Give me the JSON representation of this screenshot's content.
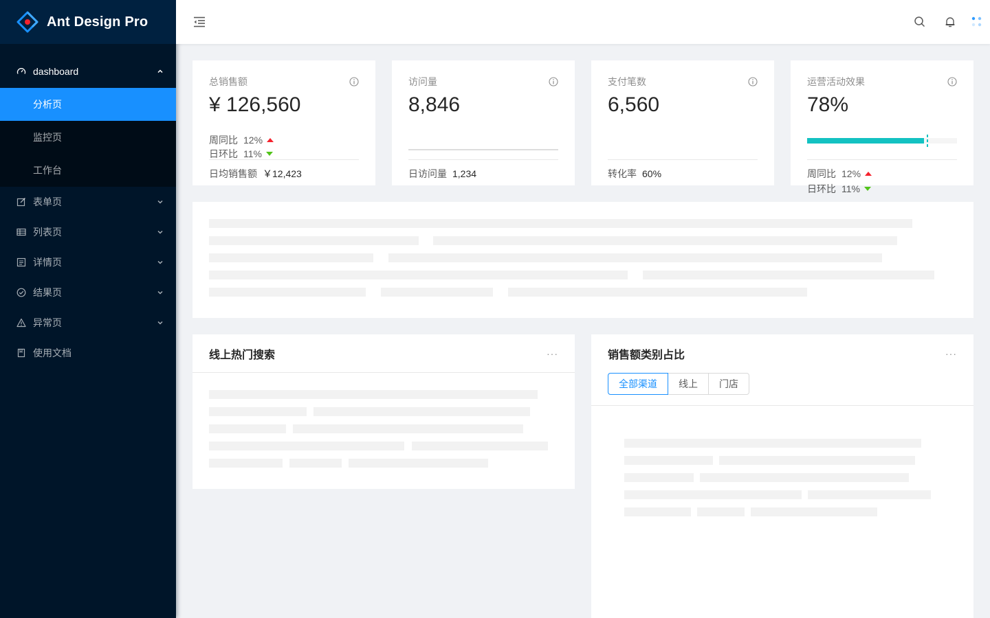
{
  "app": {
    "title": "Ant Design Pro"
  },
  "sidebar": {
    "dashboard_label": "dashboard",
    "dashboard_children": [
      {
        "label": "分析页",
        "active": true
      },
      {
        "label": "监控页",
        "active": false
      },
      {
        "label": "工作台",
        "active": false
      }
    ],
    "items": [
      {
        "label": "表单页",
        "icon": "form-icon"
      },
      {
        "label": "列表页",
        "icon": "table-icon"
      },
      {
        "label": "详情页",
        "icon": "profile-icon"
      },
      {
        "label": "结果页",
        "icon": "check-circle-icon"
      },
      {
        "label": "异常页",
        "icon": "warning-icon"
      },
      {
        "label": "使用文档",
        "icon": "book-icon"
      }
    ]
  },
  "stats": {
    "sales": {
      "title": "总销售额",
      "total": "¥ 126,560",
      "week_label": "周同比",
      "week_value": "12%",
      "day_label": "日环比",
      "day_value": "11%",
      "footer_label": "日均销售额",
      "footer_value": "￥12,423"
    },
    "visits": {
      "title": "访问量",
      "total": "8,846",
      "footer_label": "日访问量",
      "footer_value": "1,234"
    },
    "payments": {
      "title": "支付笔数",
      "total": "6,560",
      "footer_label": "转化率",
      "footer_value": "60%"
    },
    "operations": {
      "title": "运营活动效果",
      "total": "78%",
      "progress_percent": 78,
      "target_percent": 80,
      "week_label": "周同比",
      "week_value": "12%",
      "day_label": "日环比",
      "day_value": "11%"
    }
  },
  "search_card": {
    "title": "线上热门搜索",
    "more": "···"
  },
  "category_card": {
    "title": "销售额类别占比",
    "more": "···",
    "tabs": [
      "全部渠道",
      "线上",
      "门店"
    ],
    "selected_tab": "全部渠道"
  },
  "colors": {
    "sider_bg": "#001529",
    "primary": "#1890ff",
    "progress": "#13c2c2",
    "up": "#f5222d",
    "down": "#52c41a"
  }
}
